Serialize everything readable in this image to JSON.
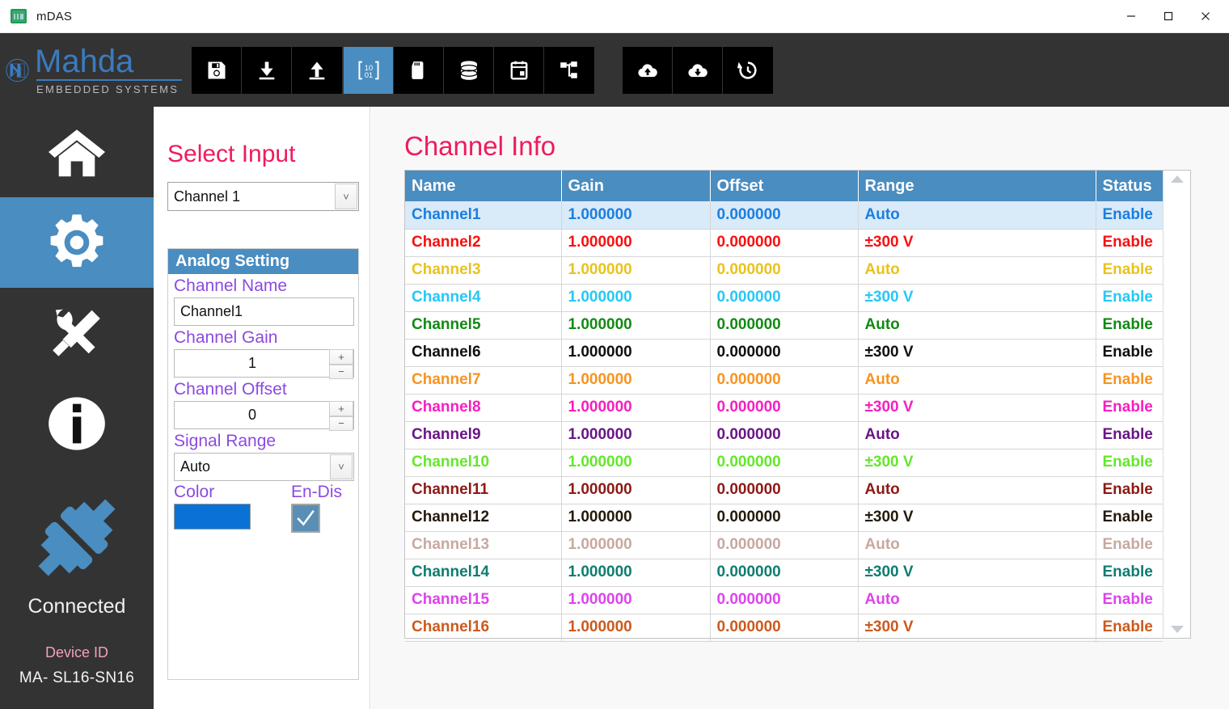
{
  "window": {
    "title": "mDAS",
    "app_icon": "chart-app-icon",
    "controls": [
      {
        "name": "minimize-button",
        "glyph": "—"
      },
      {
        "name": "maximize-button",
        "glyph": "□"
      },
      {
        "name": "close-button",
        "glyph": "✕"
      }
    ]
  },
  "brand": {
    "name": "Mahda",
    "tagline": "EMBEDDED SYSTEMS",
    "accent": "#3b7bbf"
  },
  "toolbar": {
    "active_index": 3,
    "left_group": [
      {
        "name": "save-icon",
        "label": "Save"
      },
      {
        "name": "download-icon",
        "label": "Download"
      },
      {
        "name": "upload-icon",
        "label": "Upload"
      }
    ],
    "middle_group": [
      {
        "name": "binary-icon",
        "label": "Binary"
      },
      {
        "name": "sd-card-icon",
        "label": "SD Card"
      },
      {
        "name": "database-icon",
        "label": "Database"
      },
      {
        "name": "calendar-icon",
        "label": "Calendar"
      },
      {
        "name": "network-icon",
        "label": "Network"
      }
    ],
    "right_group": [
      {
        "name": "cloud-upload-icon",
        "label": "Cloud Upload"
      },
      {
        "name": "cloud-download-icon",
        "label": "Cloud Download"
      },
      {
        "name": "history-icon",
        "label": "History"
      }
    ]
  },
  "sidebar": {
    "active_index": 1,
    "items": [
      {
        "name": "sidebar-item-home",
        "icon": "home-icon",
        "label": "Home"
      },
      {
        "name": "sidebar-item-settings",
        "icon": "gear-icon",
        "label": "Settings"
      },
      {
        "name": "sidebar-item-tools",
        "icon": "tools-icon",
        "label": "Tools"
      },
      {
        "name": "sidebar-item-info",
        "icon": "info-icon",
        "label": "Info"
      }
    ],
    "connection": {
      "icon": "plug-connected-icon",
      "status": "Connected",
      "device_id_label": "Device ID",
      "device_id_value": "MA- SL16-SN16",
      "status_color": "#4a8dc0"
    }
  },
  "left_panel": {
    "select_input_title": "Select Input",
    "channel_select_value": "Channel 1",
    "analog_setting": {
      "header": "Analog Setting",
      "channel_name_label": "Channel Name",
      "channel_name_value": "Channel1",
      "channel_gain_label": "Channel Gain",
      "channel_gain_value": "1",
      "channel_offset_label": "Channel Offset",
      "channel_offset_value": "0",
      "signal_range_label": "Signal Range",
      "signal_range_value": "Auto",
      "color_label": "Color",
      "color_value": "#0a72d6",
      "endis_label": "En-Dis",
      "endis_checked": true,
      "plus_glyph": "+",
      "minus_glyph": "−"
    }
  },
  "main": {
    "title": "Channel Info",
    "columns": [
      "Name",
      "Gain",
      "Offset",
      "Range",
      "Status"
    ],
    "selected_row": 0,
    "rows": [
      {
        "name": "Channel1",
        "gain": "1.000000",
        "offset": "0.000000",
        "range": "Auto",
        "status": "Enable",
        "color": "#1a7fe0"
      },
      {
        "name": "Channel2",
        "gain": "1.000000",
        "offset": "0.000000",
        "range": "±300 V",
        "status": "Enable",
        "color": "#fa0f0f"
      },
      {
        "name": "Channel3",
        "gain": "1.000000",
        "offset": "0.000000",
        "range": "Auto",
        "status": "Enable",
        "color": "#e8c31e"
      },
      {
        "name": "Channel4",
        "gain": "1.000000",
        "offset": "0.000000",
        "range": "±300 V",
        "status": "Enable",
        "color": "#25c8f5"
      },
      {
        "name": "Channel5",
        "gain": "1.000000",
        "offset": "0.000000",
        "range": "Auto",
        "status": "Enable",
        "color": "#128a14"
      },
      {
        "name": "Channel6",
        "gain": "1.000000",
        "offset": "0.000000",
        "range": "±300 V",
        "status": "Enable",
        "color": "#101010"
      },
      {
        "name": "Channel7",
        "gain": "1.000000",
        "offset": "0.000000",
        "range": "Auto",
        "status": "Enable",
        "color": "#f79421"
      },
      {
        "name": "Channel8",
        "gain": "1.000000",
        "offset": "0.000000",
        "range": "±300 V",
        "status": "Enable",
        "color": "#f51fc0"
      },
      {
        "name": "Channel9",
        "gain": "1.000000",
        "offset": "0.000000",
        "range": "Auto",
        "status": "Enable",
        "color": "#6a1687"
      },
      {
        "name": "Channel10",
        "gain": "1.000000",
        "offset": "0.000000",
        "range": "±300 V",
        "status": "Enable",
        "color": "#63e82a"
      },
      {
        "name": "Channel11",
        "gain": "1.000000",
        "offset": "0.000000",
        "range": "Auto",
        "status": "Enable",
        "color": "#8d1a16"
      },
      {
        "name": "Channel12",
        "gain": "1.000000",
        "offset": "0.000000",
        "range": "±300 V",
        "status": "Enable",
        "color": "#231a0b"
      },
      {
        "name": "Channel13",
        "gain": "1.000000",
        "offset": "0.000000",
        "range": "Auto",
        "status": "Enable",
        "color": "#c6a99f"
      },
      {
        "name": "Channel14",
        "gain": "1.000000",
        "offset": "0.000000",
        "range": "±300 V",
        "status": "Enable",
        "color": "#0d7d70"
      },
      {
        "name": "Channel15",
        "gain": "1.000000",
        "offset": "0.000000",
        "range": "Auto",
        "status": "Enable",
        "color": "#dc44ec"
      },
      {
        "name": "Channel16",
        "gain": "1.000000",
        "offset": "0.000000",
        "range": "±300 V",
        "status": "Enable",
        "color": "#cc5a1c"
      }
    ],
    "scrollbar": {
      "up": "scroll-up-arrow",
      "down": "scroll-down-arrow"
    }
  }
}
